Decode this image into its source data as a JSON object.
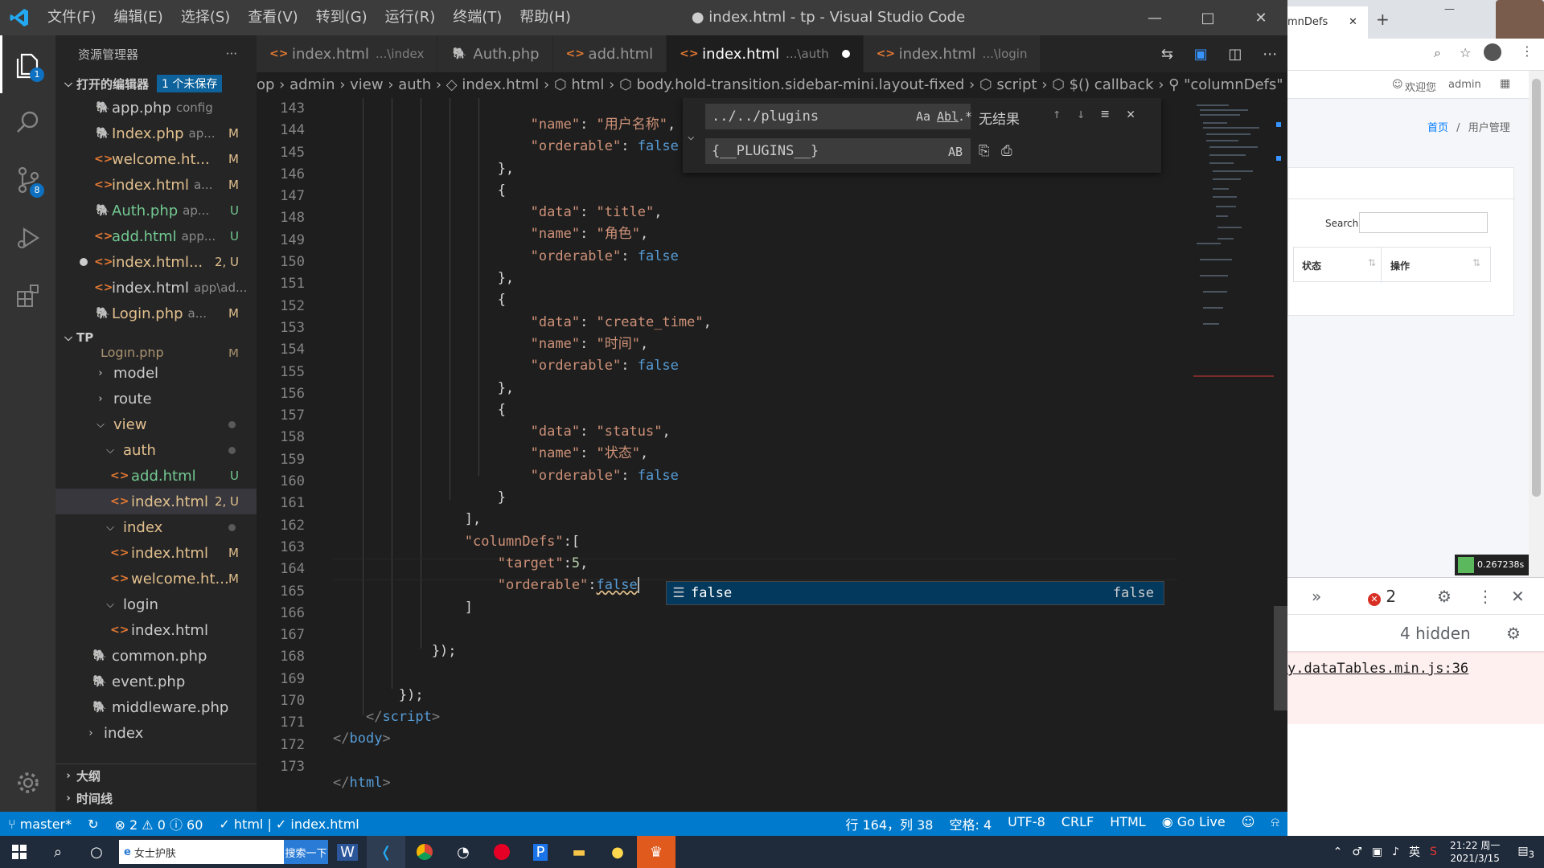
{
  "window": {
    "title": "● index.html - tp - Visual Studio Code",
    "menu": [
      "文件(F)",
      "编辑(E)",
      "选择(S)",
      "查看(V)",
      "转到(G)",
      "运行(R)",
      "终端(T)",
      "帮助(H)"
    ]
  },
  "activity": {
    "explorer_badge": "1",
    "scm_badge": "8"
  },
  "sidebar": {
    "title": "资源管理器",
    "more": "···",
    "open_editors": {
      "label": "打开的编辑器",
      "badge": "1 个未保存"
    },
    "open_files": [
      {
        "name": "app.php",
        "dir": "config",
        "status": "",
        "kind": "php"
      },
      {
        "name": "Index.php",
        "dir": "ap...",
        "status": "M",
        "kind": "php"
      },
      {
        "name": "welcome.ht...",
        "dir": "",
        "status": "M",
        "kind": "html"
      },
      {
        "name": "index.html",
        "dir": "a...",
        "status": "M",
        "kind": "html"
      },
      {
        "name": "Auth.php",
        "dir": "ap...",
        "status": "U",
        "kind": "php"
      },
      {
        "name": "add.html",
        "dir": "app...",
        "status": "U",
        "kind": "html"
      },
      {
        "name": "index.html...",
        "dir": "",
        "status": "2, U",
        "kind": "html"
      },
      {
        "name": "index.html",
        "dir": "app\\ad...",
        "status": "",
        "kind": "html"
      },
      {
        "name": "Login.php",
        "dir": "a...",
        "status": "M",
        "kind": "php"
      }
    ],
    "project": {
      "label": "TP"
    },
    "tree": {
      "partial_top": "Login.php",
      "partial_top_status": "M",
      "model": "model",
      "route": "route",
      "view": "view",
      "auth": "auth",
      "auth_add": "add.html",
      "auth_add_status": "U",
      "auth_index": "index.html",
      "auth_index_status": "2, U",
      "index": "index",
      "index_index": "index.html",
      "index_index_status": "M",
      "index_welcome": "welcome.ht...",
      "index_welcome_status": "M",
      "login": "login",
      "login_index": "index.html",
      "common": "common.php",
      "event": "event.php",
      "middleware": "middleware.php",
      "root_index": "index"
    },
    "outline": "大纲",
    "timeline": "时间线"
  },
  "tabs": [
    {
      "label": "index.html",
      "dir": "...\\index",
      "active": false
    },
    {
      "label": "Auth.php",
      "dir": "",
      "active": false
    },
    {
      "label": "add.html",
      "dir": "",
      "active": false
    },
    {
      "label": "index.html",
      "dir": "...\\auth",
      "active": true
    },
    {
      "label": "index.html",
      "dir": "...\\login",
      "active": false
    }
  ],
  "breadcrumb": "op › admin › view › auth › ◇ index.html › ⬡ html › ⬡ body.hold-transition.sidebar-mini.layout-fixed › ⬡ script › ⬡ $() callback › ⚲ \"columnDefs\"",
  "find": {
    "search_value": "../../plugins",
    "replace_value": "{__PLUGINS__}",
    "opt_case": "Aa",
    "opt_word": "Abl",
    "opt_regex": ".*",
    "opt_preserve": "AB",
    "result": "无结果"
  },
  "suggest": {
    "label": "false",
    "type": "false"
  },
  "statusbar": {
    "branch": "master*",
    "errors": "⊗ 2 ⚠ 0 ⓘ 60",
    "lang_check": "✓ html | ✓ index.html",
    "position": "行 164，列 38",
    "spaces": "空格: 4",
    "encoding": "UTF-8",
    "eol": "CRLF",
    "language": "HTML",
    "golive": "Go Live"
  },
  "browser": {
    "tab_title": "mnDefs",
    "welcome": "欢迎您",
    "user": "admin",
    "crumb_home": "首页",
    "crumb_sep": "/",
    "crumb_page": "用户管理",
    "search_label": "Search:",
    "col_status": "状态",
    "col_action": "操作",
    "timer": "0.267238s",
    "dt_errors": "2",
    "dt_hidden": "4 hidden",
    "dt_link": "y.dataTables.min.js:36"
  },
  "taskbar": {
    "search_text": "女士护肤",
    "search_btn": "搜索一下",
    "time": "21:22 周一",
    "date": "2021/3/15",
    "ime": "英",
    "notif": "3"
  }
}
